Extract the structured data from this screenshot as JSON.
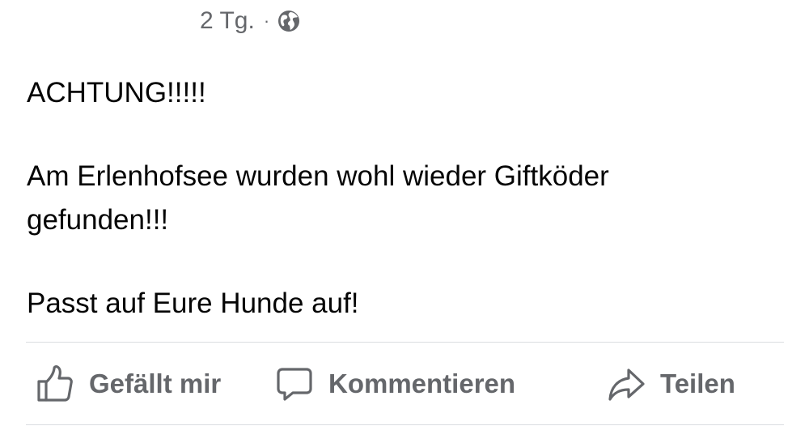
{
  "post": {
    "timestamp": "2 Tg.",
    "separator": "·",
    "audience_icon": "globe-icon",
    "paragraphs": [
      "ACHTUNG!!!!!",
      "Am Erlenhofsee wurden wohl wieder Giftköder\ngefunden!!!",
      "Passt auf Eure Hunde auf!"
    ]
  },
  "actions": {
    "like": {
      "label": "Gefällt mir",
      "icon": "thumbs-up-icon"
    },
    "comment": {
      "label": "Kommentieren",
      "icon": "comment-bubble-icon"
    },
    "share": {
      "label": "Teilen",
      "icon": "share-arrow-icon"
    }
  },
  "colors": {
    "text_primary": "#050505",
    "text_secondary": "#65676b",
    "divider": "#dadde1",
    "background": "#ffffff"
  }
}
